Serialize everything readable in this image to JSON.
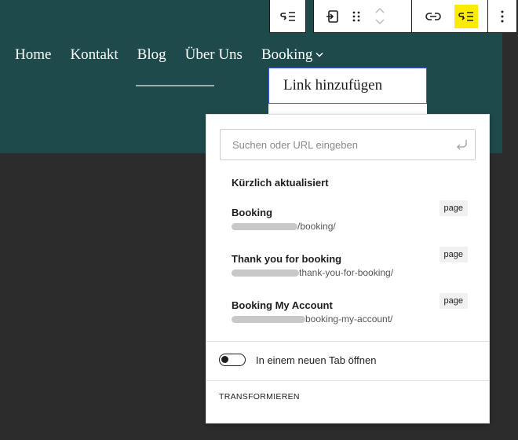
{
  "toolbar": {
    "buttons": [
      {
        "icon": "submenu-icon"
      },
      {
        "icon": "transform-icon"
      },
      {
        "icon": "drag-handle-icon"
      },
      {
        "icon": "move-up-icon"
      },
      {
        "icon": "move-down-icon"
      },
      {
        "icon": "link-icon"
      },
      {
        "icon": "add-submenu-icon"
      },
      {
        "icon": "more-options-icon"
      }
    ],
    "active_color": "#ffeb00"
  },
  "nav": {
    "items": [
      "Home",
      "Kontakt",
      "Blog",
      "Über Uns",
      "Booking"
    ]
  },
  "submenu": {
    "label": "Link hinzufügen"
  },
  "popover": {
    "search_placeholder": "Suchen oder URL eingeben",
    "recent_label": "Kürzlich aktualisiert",
    "results": [
      {
        "title": "Booking",
        "url": "/booking/",
        "badge": "page"
      },
      {
        "title": "Thank you for booking",
        "url": "thank-you-for-booking/",
        "badge": "page"
      },
      {
        "title": "Booking My Account",
        "url": "booking-my-account/",
        "badge": "page"
      }
    ],
    "new_tab_label": "In einem neuen Tab öffnen",
    "new_tab_enabled": false,
    "transform_label": "TRANSFORMIEREN"
  },
  "colors": {
    "header_bg": "#1e4a4c",
    "page_bg": "#2c2c2c",
    "focus_border": "#3858e9"
  }
}
